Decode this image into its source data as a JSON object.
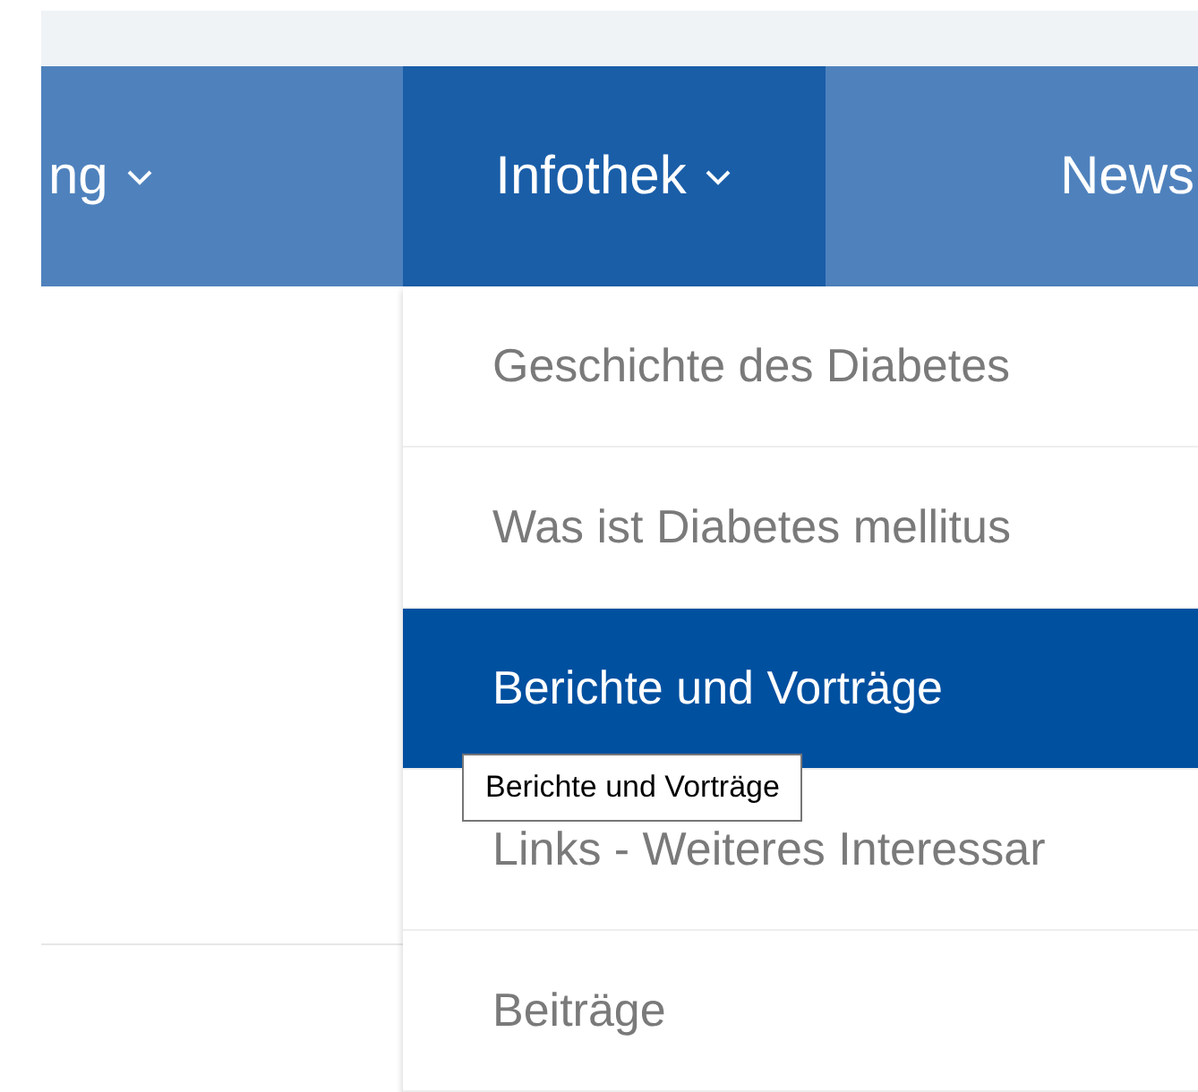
{
  "nav": {
    "items": [
      {
        "label": "ng",
        "has_dropdown": true,
        "selected": false
      },
      {
        "label": "Infothek",
        "has_dropdown": true,
        "selected": true
      },
      {
        "label": "News",
        "has_dropdown": false,
        "selected": false
      }
    ]
  },
  "dropdown": {
    "items": [
      {
        "label": "Geschichte des Diabetes",
        "selected": false
      },
      {
        "label": "Was ist Diabetes mellitus",
        "selected": false
      },
      {
        "label": "Berichte und Vorträge",
        "selected": true
      },
      {
        "label": "Links - Weiteres Interessar",
        "selected": false
      },
      {
        "label": "Beiträge",
        "selected": false
      }
    ]
  },
  "tooltip": {
    "text": "Berichte und Vorträge"
  }
}
